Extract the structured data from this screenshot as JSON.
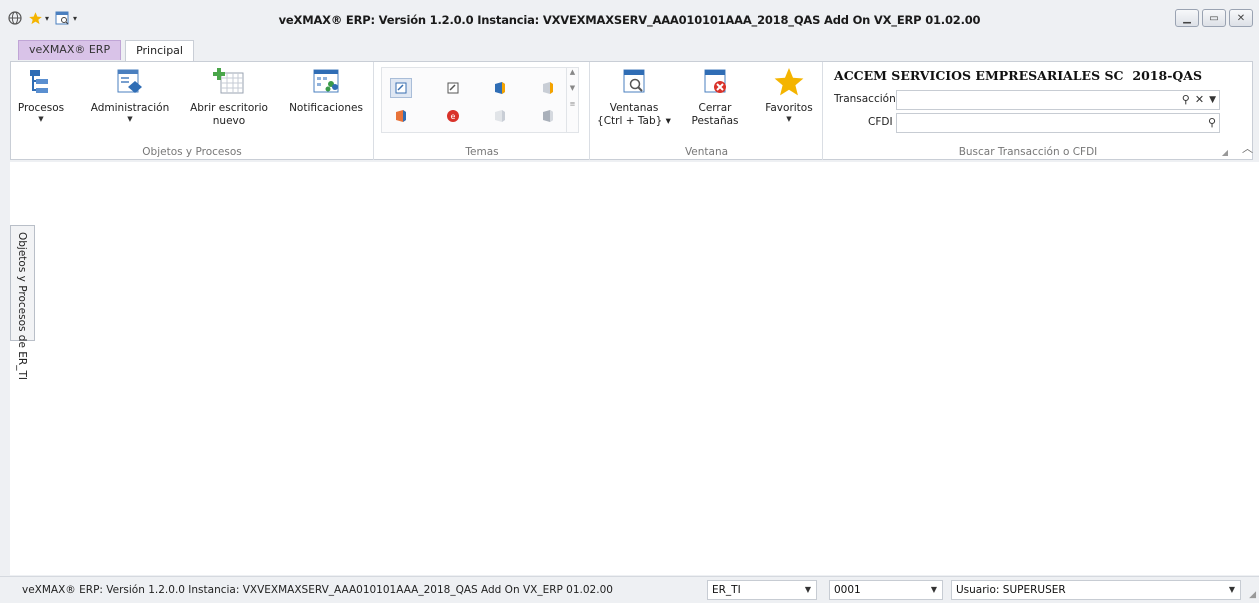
{
  "window": {
    "title": "veXMAX® ERP: Versión 1.2.0.0  Instancia: VXVEXMAXSERV_AAA010101AAA_2018_QAS  Add On VX_ERP 01.02.00",
    "quick_access": [
      "globe-icon",
      "favorites-star-icon",
      "window-search-icon"
    ],
    "controls": [
      "minimize",
      "restore",
      "close"
    ]
  },
  "tabs": {
    "app_label": "veXMAX® ERP",
    "main_label": "Principal"
  },
  "ribbon": {
    "objetos": {
      "caption": "Objetos y Procesos",
      "procesos": "Procesos",
      "administracion": "Administración",
      "abrir_1": "Abrir escritorio",
      "abrir_2": "nuevo",
      "notificaciones": "Notificaciones"
    },
    "temas": {
      "caption": "Temas"
    },
    "ventana": {
      "caption": "Ventana",
      "ventanas_1": "Ventanas",
      "ventanas_2": "{Ctrl + Tab} ▾",
      "cerrar_1": "Cerrar",
      "cerrar_2": "Pestañas",
      "favoritos": "Favoritos"
    },
    "buscar": {
      "caption": "Buscar Transacción o CFDI",
      "company": "ACCEM SERVICIOS EMPRESARIALES SC",
      "instance": "2018-QAS",
      "transaccion_label": "Transacción",
      "cfdi_label": "CFDI",
      "transaccion_value": "",
      "cfdi_value": ""
    }
  },
  "side_panel": {
    "label": "Objetos y Procesos de ER_TI"
  },
  "statusbar": {
    "text": "veXMAX® ERP: Versión 1.2.0.0  Instancia: VXVEXMAXSERV_AAA010101AAA_2018_QAS  Add On VX_ERP 01.02.00",
    "company_code": "ER_TI",
    "branch": "0001",
    "user": "Usuario: SUPERUSER"
  },
  "colors": {
    "accent_blue": "#3a6fb0",
    "star": "#f4b400",
    "app_tab": "#d9c3e8",
    "close_red": "#d9322a"
  }
}
